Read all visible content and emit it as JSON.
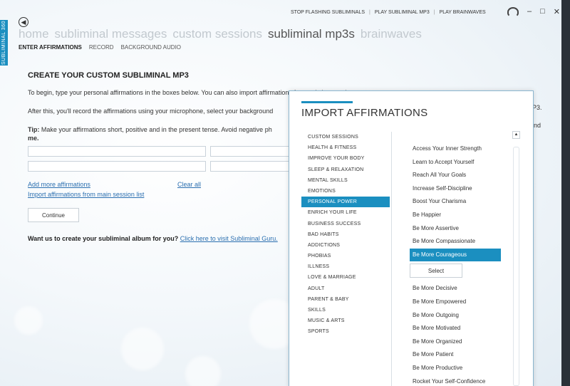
{
  "window": {
    "side_tab": "SUBLIMINAL 360",
    "top_links": [
      "STOP FLASHING SUBLIMINALS",
      "PLAY SUBLIMINAL MP3",
      "PLAY BRAINWAVES"
    ],
    "controls": {
      "minimize": "–",
      "maximize": "□",
      "close": "✕"
    }
  },
  "main_nav": [
    "home",
    "subliminal messages",
    "custom sessions",
    "subliminal mp3s",
    "brainwaves"
  ],
  "main_nav_active": 3,
  "sub_nav": [
    "ENTER AFFIRMATIONS",
    "RECORD",
    "BACKGROUND AUDIO"
  ],
  "content": {
    "title": "CREATE YOUR CUSTOM SUBLIMINAL MP3",
    "para1": "To begin, type your personal affirmations in the boxes below. You can also import affirmations from existing sessions.",
    "para2": "After this, you'll record the affirmations using your microphone, select your background",
    "para2_tail": "P3.",
    "tip_label": "Tip:",
    "tip_text": " Make your affirmations short, positive and in the present tense. Avoid negative ph",
    "tip_tail": "nd",
    "tip_tail2": "me.",
    "add_more": "Add more affirmations",
    "import_link": "Import affirmations from main session list",
    "clear_all": "Clear all",
    "continue": "Continue",
    "cta_text": "Want us to create your subliminal album for you? ",
    "cta_link": "Click here to visit Subliminal Guru."
  },
  "modal": {
    "title": "IMPORT AFFIRMATIONS",
    "categories": [
      "CUSTOM SESSIONS",
      "HEALTH & FITNESS",
      "IMPROVE YOUR BODY",
      "SLEEP & RELAXATION",
      "MENTAL SKILLS",
      "EMOTIONS",
      "PERSONAL POWER",
      "ENRICH YOUR LIFE",
      "BUSINESS SUCCESS",
      "BAD HABITS",
      "ADDICTIONS",
      "PHOBIAS",
      "ILLNESS",
      "LOVE & MARRIAGE",
      "ADULT",
      "PARENT & BABY",
      "SKILLS",
      "MUSIC & ARTS",
      "SPORTS"
    ],
    "selected_category": 6,
    "affirmations_top": [
      "Access Your Inner Strength",
      "Learn to Accept Yourself",
      "Reach All Your Goals",
      "Increase Self-Discipline",
      "Boost Your Charisma",
      "Be Happier",
      "Be More Assertive",
      "Be More Compassionate",
      "Be More Courageous"
    ],
    "selected_affirmation": 8,
    "select_label": "Select",
    "affirmations_bottom": [
      "Be More Decisive",
      "Be More Empowered",
      "Be More Outgoing",
      "Be More Motivated",
      "Be More Organized",
      "Be More Patient",
      "Be More Productive",
      "Rocket Your Self-Confidence"
    ],
    "scroll_up": "▲"
  },
  "colors": {
    "accent": "#1b8fc0",
    "link": "#2b6fb0"
  }
}
